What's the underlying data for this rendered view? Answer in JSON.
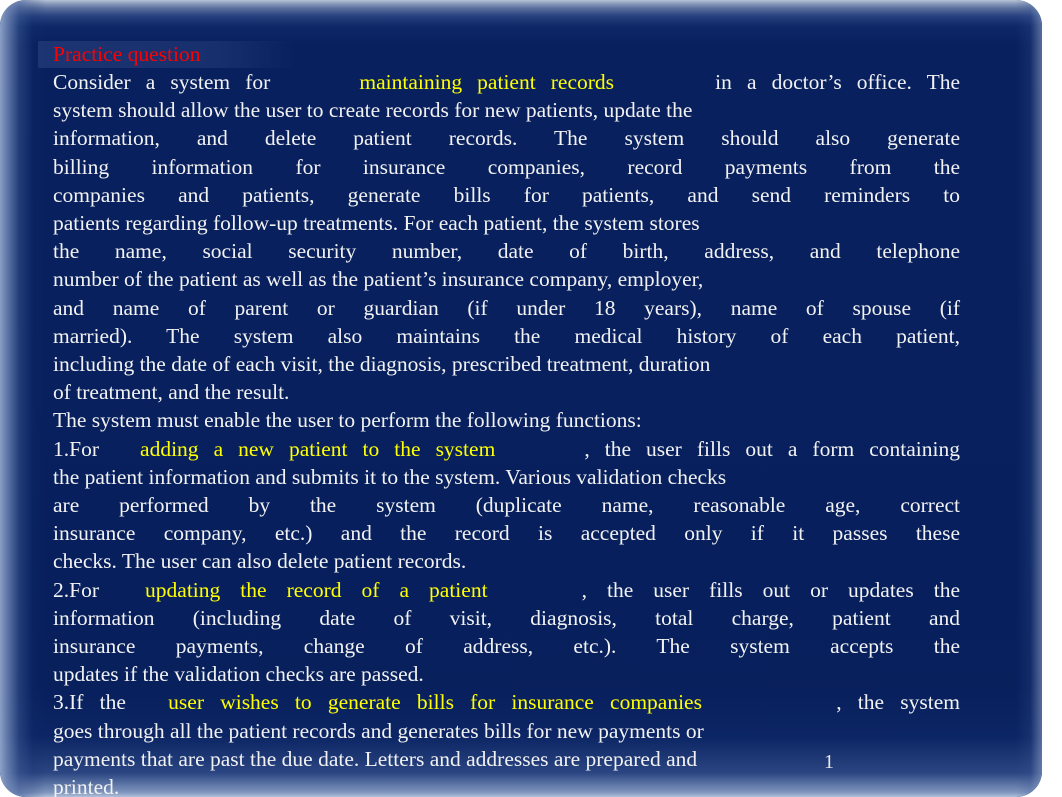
{
  "slide": {
    "title": "Practice question",
    "page_number": "1",
    "colors": {
      "background_navy": "#07205d",
      "background_top_light": "#b9c4d8",
      "title_red": "#ff0000",
      "highlight_yellow": "#ffff00",
      "body_text": "#f2f2f2"
    },
    "lines": [
      {
        "id": "l01",
        "justify": true,
        "runs": [
          {
            "text": "Consider a system for",
            "color": "white"
          },
          {
            "text": "GAP_MD",
            "color": "gap"
          },
          {
            "text": "maintaining patient records",
            "color": "yellow"
          },
          {
            "text": "GAP_LG",
            "color": "gap"
          },
          {
            "text": "in a doctor’s office. The",
            "color": "white"
          }
        ]
      },
      {
        "id": "l02",
        "justify": false,
        "runs": [
          {
            "text": "system should allow the user to create records for new patients, update the",
            "color": "white"
          }
        ]
      },
      {
        "id": "l03",
        "justify": true,
        "runs": [
          {
            "text": "information, and delete patient records. The system should also generate",
            "color": "white"
          }
        ]
      },
      {
        "id": "l04",
        "justify": true,
        "runs": [
          {
            "text": "billing information for insurance companies, record payments from the",
            "color": "white"
          }
        ]
      },
      {
        "id": "l05",
        "justify": true,
        "runs": [
          {
            "text": "companies and patients, generate bills for patients, and send reminders to",
            "color": "white"
          }
        ]
      },
      {
        "id": "l06",
        "justify": false,
        "runs": [
          {
            "text": "patients regarding follow-up treatments. For each patient, the system stores",
            "color": "white"
          }
        ]
      },
      {
        "id": "l07",
        "justify": true,
        "runs": [
          {
            "text": "the name, social security number, date of birth, address, and telephone",
            "color": "white"
          }
        ]
      },
      {
        "id": "l08",
        "justify": false,
        "runs": [
          {
            "text": "number of the patient as well as the patient’s insurance company, employer,",
            "color": "white"
          }
        ]
      },
      {
        "id": "l09",
        "justify": true,
        "runs": [
          {
            "text": "and name of parent or guardian (if under 18 years), name of spouse (if",
            "color": "white"
          }
        ]
      },
      {
        "id": "l10",
        "justify": true,
        "runs": [
          {
            "text": "married). The system also maintains the medical history of each patient,",
            "color": "white"
          }
        ]
      },
      {
        "id": "l11",
        "justify": false,
        "runs": [
          {
            "text": "including the date of each visit, the diagnosis, prescribed treatment, duration",
            "color": "white"
          }
        ]
      },
      {
        "id": "l12",
        "justify": false,
        "runs": [
          {
            "text": "of treatment, and the result.",
            "color": "white"
          }
        ]
      },
      {
        "id": "l13",
        "justify": false,
        "runs": [
          {
            "text": "The system must enable the user to perform the following functions:",
            "color": "white"
          }
        ]
      },
      {
        "id": "l14",
        "justify": true,
        "runs": [
          {
            "text": "1.For",
            "color": "white"
          },
          {
            "text": "GAP_SM",
            "color": "gap"
          },
          {
            "text": "adding a new patient to the system",
            "color": "yellow"
          },
          {
            "text": "GAP_MD",
            "color": "gap"
          },
          {
            "text": ", the user fills out a form containing",
            "color": "white"
          }
        ]
      },
      {
        "id": "l15",
        "justify": false,
        "runs": [
          {
            "text": "the patient information and submits it to the system. Various validation checks",
            "color": "white"
          }
        ]
      },
      {
        "id": "l16",
        "justify": true,
        "runs": [
          {
            "text": "are performed by the system (duplicate name, reasonable age, correct",
            "color": "white"
          }
        ]
      },
      {
        "id": "l17",
        "justify": true,
        "runs": [
          {
            "text": "insurance company, etc.) and the record is accepted only if it passes these",
            "color": "white"
          }
        ]
      },
      {
        "id": "l18",
        "justify": false,
        "runs": [
          {
            "text": "checks. The user can also delete patient records.",
            "color": "white"
          }
        ]
      },
      {
        "id": "l19",
        "justify": true,
        "runs": [
          {
            "text": "2.For",
            "color": "white"
          },
          {
            "text": "GAP_SM",
            "color": "gap"
          },
          {
            "text": "updating the record of a patient",
            "color": "yellow"
          },
          {
            "text": "GAP_MD",
            "color": "gap"
          },
          {
            "text": ", the user fills out or updates the",
            "color": "white"
          }
        ]
      },
      {
        "id": "l20",
        "justify": true,
        "runs": [
          {
            "text": "information (including date of visit, diagnosis, total charge, patient and",
            "color": "white"
          }
        ]
      },
      {
        "id": "l21",
        "justify": true,
        "runs": [
          {
            "text": "insurance payments, change of address, etc.). The system accepts the",
            "color": "white"
          }
        ]
      },
      {
        "id": "l22",
        "justify": false,
        "runs": [
          {
            "text": "updates if the validation checks are passed.",
            "color": "white"
          }
        ]
      },
      {
        "id": "l23",
        "justify": true,
        "runs": [
          {
            "text": "3.If the",
            "color": "white"
          },
          {
            "text": "GAP_SM",
            "color": "gap"
          },
          {
            "text": "user wishes to generate bills for insurance companies",
            "color": "yellow"
          },
          {
            "text": "GAP_XL",
            "color": "gap"
          },
          {
            "text": ", the system",
            "color": "white"
          }
        ]
      },
      {
        "id": "l24",
        "justify": false,
        "runs": [
          {
            "text": "goes through all the patient records and generates bills for new payments or",
            "color": "white"
          }
        ]
      },
      {
        "id": "l25",
        "justify": false,
        "runs": [
          {
            "text": "payments that are past the due date. Letters and addresses are prepared and",
            "color": "white"
          }
        ]
      },
      {
        "id": "l26",
        "justify": false,
        "runs": [
          {
            "text": "printed.",
            "color": "white"
          }
        ]
      }
    ]
  }
}
